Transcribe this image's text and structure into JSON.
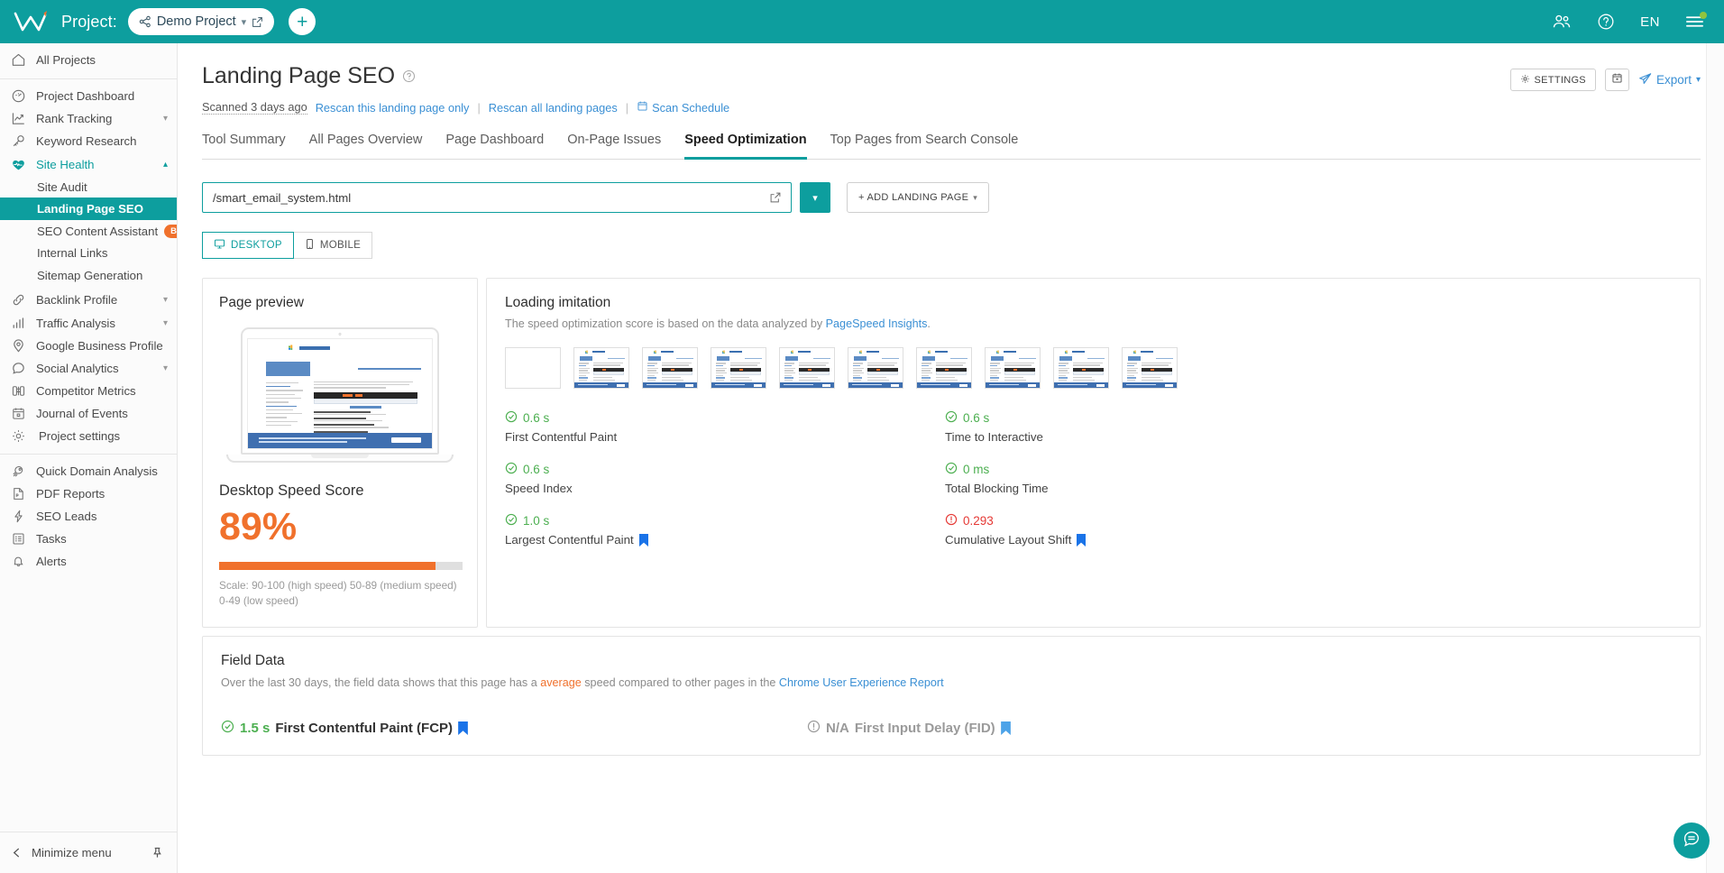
{
  "topbar": {
    "logo": "w-logo",
    "project_label": "Project:",
    "project_name": "Demo Project",
    "add_project": "+",
    "language": "EN",
    "icons": [
      "team-icon",
      "help-icon",
      "burger-menu-icon"
    ]
  },
  "sidebar": {
    "all_projects": "All Projects",
    "items": [
      {
        "label": "Project Dashboard",
        "icon": "dashboard-icon",
        "chevron": false
      },
      {
        "label": "Rank Tracking",
        "icon": "chart-up-icon",
        "chevron": true
      },
      {
        "label": "Keyword Research",
        "icon": "key-icon",
        "chevron": false
      },
      {
        "label": "Site Health",
        "icon": "heartbeat-icon",
        "chevron": true,
        "active": true
      }
    ],
    "sub_items": [
      {
        "label": "Site Audit",
        "selected": false
      },
      {
        "label": "Landing Page SEO",
        "selected": true
      },
      {
        "label": "SEO Content Assistant",
        "selected": false,
        "badge": "Beta"
      },
      {
        "label": "Internal Links",
        "selected": false
      },
      {
        "label": "Sitemap Generation",
        "selected": false
      }
    ],
    "items2": [
      {
        "label": "Backlink Profile",
        "icon": "link-icon",
        "chevron": true
      },
      {
        "label": "Traffic Analysis",
        "icon": "bar-chart-icon",
        "chevron": true
      },
      {
        "label": "Google Business Profile",
        "icon": "map-pin-icon",
        "chevron": false
      },
      {
        "label": "Social Analytics",
        "icon": "chat-bubble-icon",
        "chevron": true
      },
      {
        "label": "Competitor Metrics",
        "icon": "binoculars-icon",
        "chevron": false
      },
      {
        "label": "Journal of Events",
        "icon": "calendar-icon",
        "chevron": false
      },
      {
        "label": "Project settings",
        "icon": "gear-icon",
        "chevron": false
      }
    ],
    "items3": [
      {
        "label": "Quick Domain Analysis",
        "icon": "rocket-icon"
      },
      {
        "label": "PDF Reports",
        "icon": "pdf-file-icon"
      },
      {
        "label": "SEO Leads",
        "icon": "lightning-icon"
      },
      {
        "label": "Tasks",
        "icon": "task-list-icon"
      },
      {
        "label": "Alerts",
        "icon": "bell-icon"
      }
    ],
    "minimize": "Minimize menu"
  },
  "page": {
    "title": "Landing Page SEO",
    "scanned": "Scanned 3 days ago",
    "rescan_one": "Rescan this landing page only",
    "rescan_all": "Rescan all landing pages",
    "scan_schedule": "Scan Schedule",
    "settings_button": "SETTINGS",
    "export_button": "Export"
  },
  "tabs": [
    {
      "label": "Tool Summary",
      "active": false
    },
    {
      "label": "All Pages Overview",
      "active": false
    },
    {
      "label": "Page Dashboard",
      "active": false
    },
    {
      "label": "On-Page Issues",
      "active": false
    },
    {
      "label": "Speed Optimization",
      "active": true
    },
    {
      "label": "Top Pages from Search Console",
      "active": false
    }
  ],
  "url_bar": {
    "value": "/smart_email_system.html",
    "add_landing_page": "+ ADD LANDING PAGE"
  },
  "device_toggle": {
    "desktop": "DESKTOP",
    "mobile": "MOBILE",
    "active": "DESKTOP"
  },
  "preview": {
    "title": "Page preview",
    "score_title": "Desktop Speed Score",
    "score_value": "89%",
    "score_percent": 89,
    "score_color": "#f0712c",
    "scale_note": "Scale: 90-100 (high speed) 50-89 (medium speed) 0-49 (low speed)"
  },
  "loading": {
    "title": "Loading imitation",
    "subtitle_pre": "The speed optimization score is based on the data analyzed by ",
    "subtitle_link": "PageSpeed Insights",
    "subtitle_post": ".",
    "frames": 10,
    "metrics_left": [
      {
        "value": "0.6 s",
        "name": "First Contentful Paint",
        "status": "good",
        "bookmark": false
      },
      {
        "value": "0.6 s",
        "name": "Speed Index",
        "status": "good",
        "bookmark": false
      },
      {
        "value": "1.0 s",
        "name": "Largest Contentful Paint",
        "status": "good",
        "bookmark": true
      }
    ],
    "metrics_right": [
      {
        "value": "0.6 s",
        "name": "Time to Interactive",
        "status": "good",
        "bookmark": false
      },
      {
        "value": "0 ms",
        "name": "Total Blocking Time",
        "status": "good",
        "bookmark": false
      },
      {
        "value": "0.293",
        "name": "Cumulative Layout Shift",
        "status": "bad",
        "bookmark": true
      }
    ]
  },
  "field_data": {
    "title": "Field Data",
    "desc_pre": "Over the last 30 days, the field data shows that this page has a ",
    "desc_hl": "average",
    "desc_mid": " speed compared to other pages in the ",
    "desc_link": "Chrome User Experience Report",
    "items": [
      {
        "value": "1.5 s",
        "name": "First Contentful Paint (FCP)",
        "status": "good",
        "bookmark": true
      },
      {
        "value": "N/A",
        "name": "First Input Delay (FID)",
        "status": "na",
        "bookmark": true
      }
    ]
  },
  "chat": {
    "icon": "chat-support-icon"
  }
}
